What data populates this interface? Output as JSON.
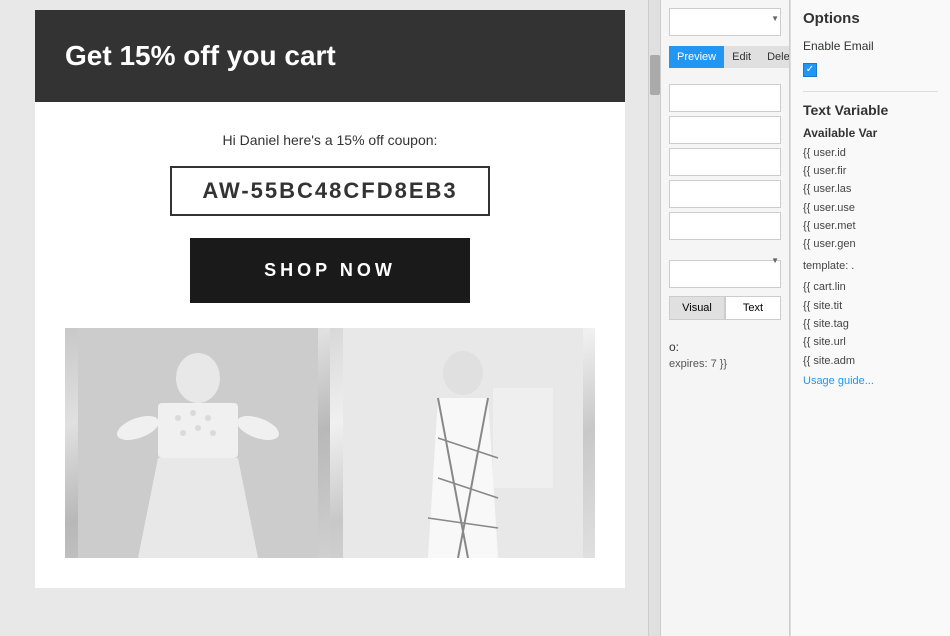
{
  "email": {
    "header": {
      "text": "Get 15% off you cart",
      "bg_color": "#333333"
    },
    "body": {
      "greeting": "Hi Daniel here's a 15% off coupon:",
      "coupon_code": "AW-55BC48CFD8EB3",
      "shop_now_label": "SHOP NOW"
    }
  },
  "controls": {
    "preview_label": "Preview",
    "edit_label": "Edit",
    "delete_label": "Delete",
    "visual_label": "Visual",
    "text_label": "Text",
    "label_colon": "o:",
    "expires_text": "expires: 7 }}"
  },
  "right_panel": {
    "options_title": "Options",
    "enable_email_label": "Enable Email",
    "checkbox_check": "✓",
    "text_variables_title": "Text Variable",
    "available_var_title": "Available Var",
    "variables": [
      "{{ user.id ",
      "{{ user.fir",
      "{{ user.las",
      "{{ user.use",
      "{{ user.met",
      "{{ user.gen",
      "template: ."
    ],
    "cart_variable": "{{ cart.lin",
    "site_variables": [
      "{{ site.tit",
      "{{ site.tag",
      "{{ site.url",
      "{{ site.adm"
    ],
    "usage_guide_label": "Usage guide..."
  }
}
